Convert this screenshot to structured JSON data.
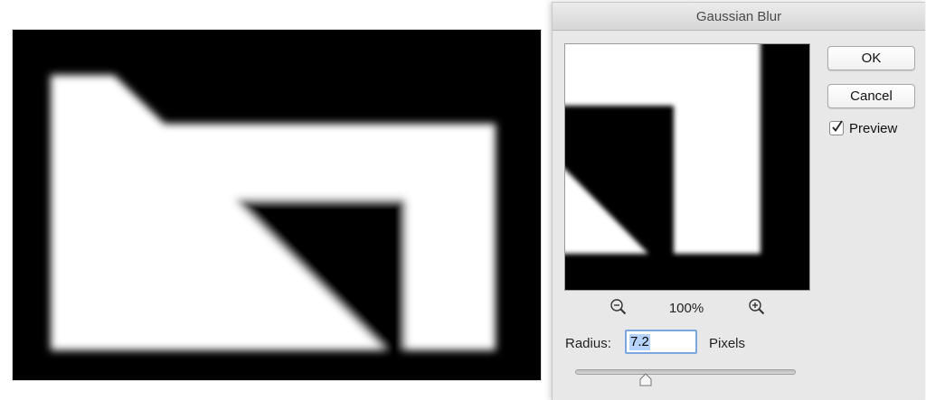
{
  "dialog": {
    "title": "Gaussian Blur",
    "ok_label": "OK",
    "cancel_label": "Cancel",
    "preview_label": "Preview",
    "preview_checked": true,
    "zoom_level": "100%",
    "zoom_out_icon": "zoom-out-icon",
    "zoom_in_icon": "zoom-in-icon",
    "radius_label": "Radius:",
    "radius_value": "7.2",
    "unit_label": "Pixels",
    "slider_level": 0.32
  },
  "colors": {
    "canvas_background": "#000000",
    "shape_fill": "#ffffff",
    "selection_highlight": "#b6d3fb",
    "focus_ring": "#7aa7e0"
  }
}
